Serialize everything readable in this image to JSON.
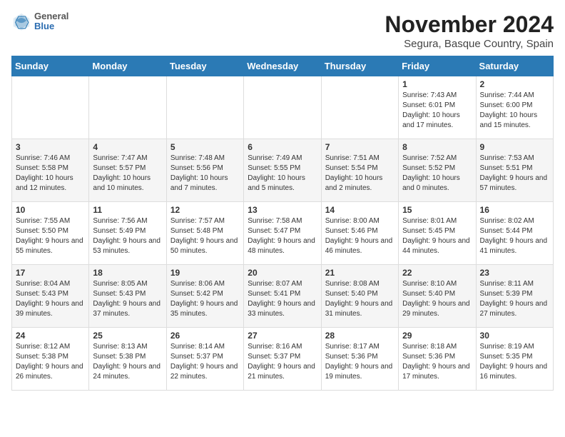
{
  "header": {
    "logo_general": "General",
    "logo_blue": "Blue",
    "month_title": "November 2024",
    "location": "Segura, Basque Country, Spain"
  },
  "days_of_week": [
    "Sunday",
    "Monday",
    "Tuesday",
    "Wednesday",
    "Thursday",
    "Friday",
    "Saturday"
  ],
  "weeks": [
    [
      {
        "day": "",
        "info": ""
      },
      {
        "day": "",
        "info": ""
      },
      {
        "day": "",
        "info": ""
      },
      {
        "day": "",
        "info": ""
      },
      {
        "day": "",
        "info": ""
      },
      {
        "day": "1",
        "info": "Sunrise: 7:43 AM\nSunset: 6:01 PM\nDaylight: 10 hours and 17 minutes."
      },
      {
        "day": "2",
        "info": "Sunrise: 7:44 AM\nSunset: 6:00 PM\nDaylight: 10 hours and 15 minutes."
      }
    ],
    [
      {
        "day": "3",
        "info": "Sunrise: 7:46 AM\nSunset: 5:58 PM\nDaylight: 10 hours and 12 minutes."
      },
      {
        "day": "4",
        "info": "Sunrise: 7:47 AM\nSunset: 5:57 PM\nDaylight: 10 hours and 10 minutes."
      },
      {
        "day": "5",
        "info": "Sunrise: 7:48 AM\nSunset: 5:56 PM\nDaylight: 10 hours and 7 minutes."
      },
      {
        "day": "6",
        "info": "Sunrise: 7:49 AM\nSunset: 5:55 PM\nDaylight: 10 hours and 5 minutes."
      },
      {
        "day": "7",
        "info": "Sunrise: 7:51 AM\nSunset: 5:54 PM\nDaylight: 10 hours and 2 minutes."
      },
      {
        "day": "8",
        "info": "Sunrise: 7:52 AM\nSunset: 5:52 PM\nDaylight: 10 hours and 0 minutes."
      },
      {
        "day": "9",
        "info": "Sunrise: 7:53 AM\nSunset: 5:51 PM\nDaylight: 9 hours and 57 minutes."
      }
    ],
    [
      {
        "day": "10",
        "info": "Sunrise: 7:55 AM\nSunset: 5:50 PM\nDaylight: 9 hours and 55 minutes."
      },
      {
        "day": "11",
        "info": "Sunrise: 7:56 AM\nSunset: 5:49 PM\nDaylight: 9 hours and 53 minutes."
      },
      {
        "day": "12",
        "info": "Sunrise: 7:57 AM\nSunset: 5:48 PM\nDaylight: 9 hours and 50 minutes."
      },
      {
        "day": "13",
        "info": "Sunrise: 7:58 AM\nSunset: 5:47 PM\nDaylight: 9 hours and 48 minutes."
      },
      {
        "day": "14",
        "info": "Sunrise: 8:00 AM\nSunset: 5:46 PM\nDaylight: 9 hours and 46 minutes."
      },
      {
        "day": "15",
        "info": "Sunrise: 8:01 AM\nSunset: 5:45 PM\nDaylight: 9 hours and 44 minutes."
      },
      {
        "day": "16",
        "info": "Sunrise: 8:02 AM\nSunset: 5:44 PM\nDaylight: 9 hours and 41 minutes."
      }
    ],
    [
      {
        "day": "17",
        "info": "Sunrise: 8:04 AM\nSunset: 5:43 PM\nDaylight: 9 hours and 39 minutes."
      },
      {
        "day": "18",
        "info": "Sunrise: 8:05 AM\nSunset: 5:43 PM\nDaylight: 9 hours and 37 minutes."
      },
      {
        "day": "19",
        "info": "Sunrise: 8:06 AM\nSunset: 5:42 PM\nDaylight: 9 hours and 35 minutes."
      },
      {
        "day": "20",
        "info": "Sunrise: 8:07 AM\nSunset: 5:41 PM\nDaylight: 9 hours and 33 minutes."
      },
      {
        "day": "21",
        "info": "Sunrise: 8:08 AM\nSunset: 5:40 PM\nDaylight: 9 hours and 31 minutes."
      },
      {
        "day": "22",
        "info": "Sunrise: 8:10 AM\nSunset: 5:40 PM\nDaylight: 9 hours and 29 minutes."
      },
      {
        "day": "23",
        "info": "Sunrise: 8:11 AM\nSunset: 5:39 PM\nDaylight: 9 hours and 27 minutes."
      }
    ],
    [
      {
        "day": "24",
        "info": "Sunrise: 8:12 AM\nSunset: 5:38 PM\nDaylight: 9 hours and 26 minutes."
      },
      {
        "day": "25",
        "info": "Sunrise: 8:13 AM\nSunset: 5:38 PM\nDaylight: 9 hours and 24 minutes."
      },
      {
        "day": "26",
        "info": "Sunrise: 8:14 AM\nSunset: 5:37 PM\nDaylight: 9 hours and 22 minutes."
      },
      {
        "day": "27",
        "info": "Sunrise: 8:16 AM\nSunset: 5:37 PM\nDaylight: 9 hours and 21 minutes."
      },
      {
        "day": "28",
        "info": "Sunrise: 8:17 AM\nSunset: 5:36 PM\nDaylight: 9 hours and 19 minutes."
      },
      {
        "day": "29",
        "info": "Sunrise: 8:18 AM\nSunset: 5:36 PM\nDaylight: 9 hours and 17 minutes."
      },
      {
        "day": "30",
        "info": "Sunrise: 8:19 AM\nSunset: 5:35 PM\nDaylight: 9 hours and 16 minutes."
      }
    ]
  ]
}
